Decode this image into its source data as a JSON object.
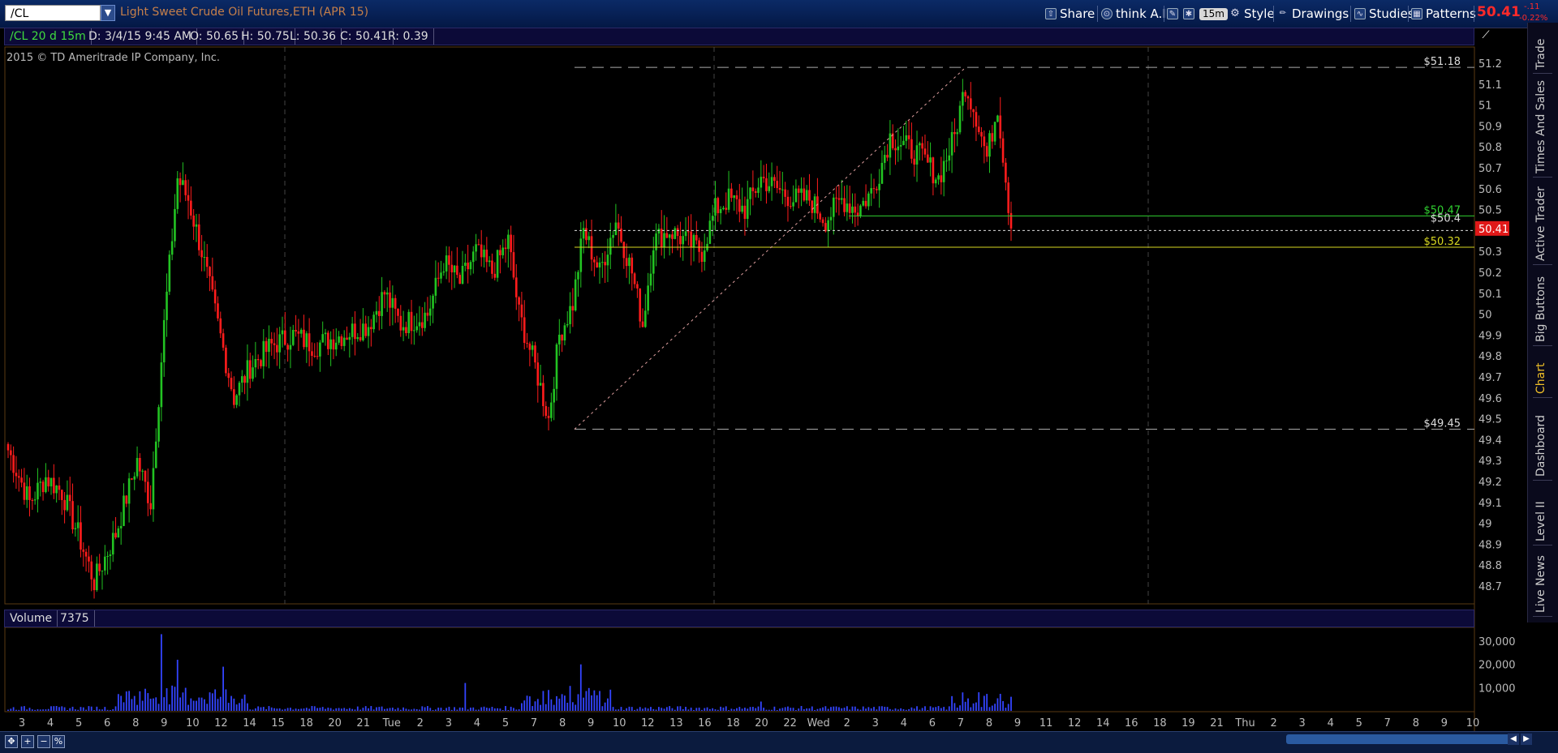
{
  "toolbar": {
    "symbol": "/CL",
    "title": "Light Sweet Crude Oil Futures,ETH (APR 15)",
    "share": "Share",
    "think": "think A.I.",
    "timeframe": "15m",
    "style": "Style",
    "drawings": "Drawings",
    "studies": "Studies",
    "patterns": "Patterns",
    "last_price": "50.41",
    "change_abs": "-.11",
    "change_pct": "-0.22%",
    "price_color": "#ff2a2a"
  },
  "infobar": {
    "symbol_period": "/CL 20 d 15m",
    "date": "D: 3/4/15 9:45 AM",
    "open": "O: 50.65",
    "high": "H: 50.75",
    "low": "L: 50.36",
    "close": "C: 50.41",
    "range": "R: 0.39"
  },
  "copyright": "2015 © TD Ameritrade IP Company, Inc.",
  "side_tabs": [
    "Trade",
    "Times And Sales",
    "Active Trader",
    "Big Buttons",
    "Chart",
    "Dashboard",
    "Level II",
    "Live News"
  ],
  "active_tab": "Chart",
  "volume_header": {
    "label": "Volume",
    "value": "7375"
  },
  "price_labels": {
    "upper": "$51.18",
    "green": "$50.47",
    "mid": "$50.4",
    "yellow": "$50.32",
    "lower": "$49.45",
    "current": "50.41"
  },
  "colors": {
    "up": "#22c322",
    "down": "#ff1c1c",
    "volume": "#3344ff",
    "green_line": "#30d030",
    "yellow_line": "#d8d820"
  },
  "chart_data": {
    "type": "candlestick",
    "y_ticks": [
      "51.2",
      "51.1",
      "51",
      "50.9",
      "50.8",
      "50.7",
      "50.6",
      "50.5",
      "50.4",
      "50.3",
      "50.2",
      "50.1",
      "50",
      "49.9",
      "49.8",
      "49.7",
      "49.6",
      "49.5",
      "49.4",
      "49.3",
      "49.2",
      "49.1",
      "49",
      "48.9",
      "48.8",
      "48.7"
    ],
    "ylim": [
      48.64,
      51.32
    ],
    "x_ticks": [
      "3",
      "4",
      "5",
      "6",
      "8",
      "9",
      "10",
      "12",
      "14",
      "15",
      "18",
      "20",
      "21",
      "Tue",
      "2",
      "3",
      "4",
      "5",
      "7",
      "8",
      "9",
      "10",
      "12",
      "13",
      "16",
      "18",
      "20",
      "22",
      "Wed",
      "2",
      "3",
      "4",
      "6",
      "7",
      "8",
      "9",
      "11",
      "12",
      "14",
      "16",
      "18",
      "19",
      "21",
      "Thu",
      "2",
      "3",
      "4",
      "5",
      "7",
      "8",
      "9",
      "10"
    ],
    "horizontal_levels": [
      51.18,
      50.47,
      50.4,
      50.32,
      49.45
    ],
    "last": 50.41,
    "volume_ticks": [
      "30,000",
      "20,000",
      "10,000"
    ],
    "volume_max": 34000,
    "anchors": [
      [
        0,
        49.35
      ],
      [
        8,
        49.1
      ],
      [
        14,
        49.22
      ],
      [
        20,
        49.15
      ],
      [
        26,
        48.95
      ],
      [
        32,
        48.72
      ],
      [
        40,
        48.95
      ],
      [
        48,
        49.3
      ],
      [
        53,
        49.1
      ],
      [
        58,
        49.95
      ],
      [
        63,
        50.65
      ],
      [
        67,
        50.55
      ],
      [
        72,
        50.3
      ],
      [
        78,
        49.95
      ],
      [
        84,
        49.6
      ],
      [
        90,
        49.75
      ],
      [
        98,
        49.85
      ],
      [
        106,
        49.9
      ],
      [
        114,
        49.85
      ],
      [
        124,
        49.9
      ],
      [
        134,
        49.95
      ],
      [
        140,
        50.1
      ],
      [
        146,
        49.95
      ],
      [
        156,
        50.0
      ],
      [
        162,
        50.25
      ],
      [
        168,
        50.15
      ],
      [
        174,
        50.3
      ],
      [
        180,
        50.2
      ],
      [
        186,
        50.35
      ],
      [
        190,
        50.0
      ],
      [
        196,
        49.75
      ],
      [
        201,
        49.5
      ],
      [
        205,
        49.9
      ],
      [
        210,
        50.05
      ],
      [
        214,
        50.4
      ],
      [
        220,
        50.2
      ],
      [
        226,
        50.45
      ],
      [
        232,
        50.2
      ],
      [
        236,
        49.95
      ],
      [
        240,
        50.35
      ],
      [
        246,
        50.4
      ],
      [
        252,
        50.35
      ],
      [
        258,
        50.3
      ],
      [
        263,
        50.5
      ],
      [
        268,
        50.55
      ],
      [
        274,
        50.5
      ],
      [
        280,
        50.65
      ],
      [
        286,
        50.6
      ],
      [
        292,
        50.55
      ],
      [
        298,
        50.55
      ],
      [
        304,
        50.45
      ],
      [
        310,
        50.55
      ],
      [
        316,
        50.5
      ],
      [
        322,
        50.6
      ],
      [
        328,
        50.85
      ],
      [
        334,
        50.8
      ],
      [
        340,
        50.75
      ],
      [
        346,
        50.65
      ],
      [
        352,
        50.85
      ],
      [
        356,
        51.1
      ],
      [
        360,
        50.95
      ],
      [
        364,
        50.75
      ],
      [
        368,
        51.0
      ],
      [
        371,
        50.65
      ],
      [
        373,
        50.41
      ]
    ]
  }
}
